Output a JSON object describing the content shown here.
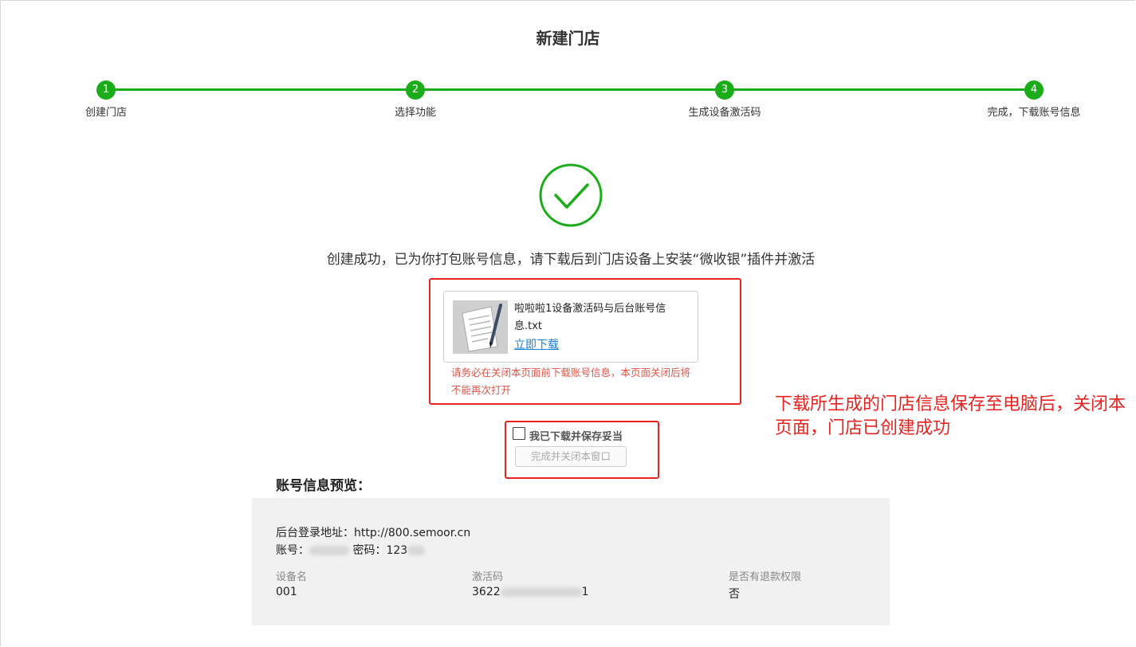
{
  "page": {
    "title": "新建门店"
  },
  "steps": [
    {
      "number": "1",
      "label": "创建门店"
    },
    {
      "number": "2",
      "label": "选择功能"
    },
    {
      "number": "3",
      "label": "生成设备激活码"
    },
    {
      "number": "4",
      "label": "完成，下载账号信息"
    }
  ],
  "success": {
    "icon": "check-circle-icon",
    "message": "创建成功，已为你打包账号信息，请下载后到门店设备上安装“微收银”插件并激活"
  },
  "file": {
    "icon": "notepad-pen-icon",
    "name": "啦啦啦1设备激活码与后台账号信息.txt",
    "download_label": "立即下载",
    "warning": "请务必在关闭本页面前下载账号信息，本页面关闭后将不能再次打开"
  },
  "confirm": {
    "checkbox_label": "我已下载并保存妥当",
    "checked": false,
    "close_button": "完成并关闭本窗口"
  },
  "annotation": "下载所生成的门店信息保存至电脑后，关闭本页面，门店已创建成功",
  "preview": {
    "title": "账号信息预览：",
    "login_url": "后台登录地址：http://800.semoor.cn",
    "account_label": "账号：",
    "password_label": "密码：",
    "password_visible": "123",
    "columns": [
      "设备名",
      "激活码",
      "是否有退款权限"
    ],
    "row": {
      "device_name": "001",
      "activation_code_visible": "3622",
      "activation_code_tail": "1",
      "refund": "否"
    }
  },
  "colors": {
    "accent_green": "#1aad19",
    "annotation_red": "#e8231f",
    "link_blue": "#1a7fd9",
    "warning_red": "#e05548"
  }
}
